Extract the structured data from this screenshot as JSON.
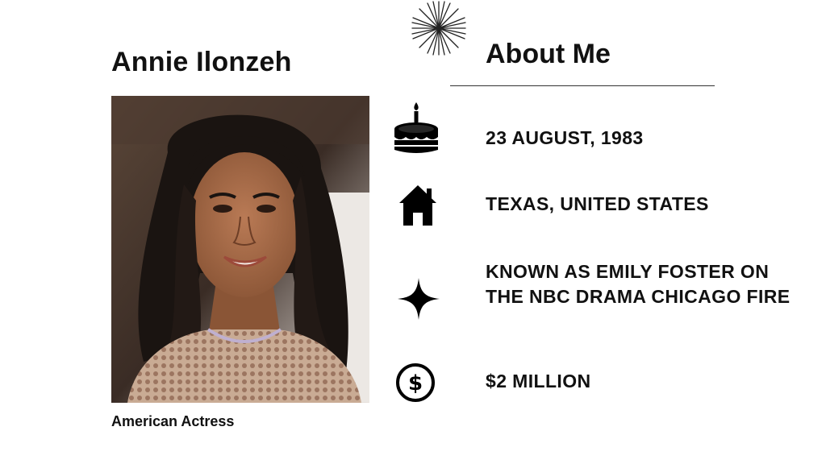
{
  "profile": {
    "name": "Annie Ilonzeh",
    "caption": "American Actress"
  },
  "about": {
    "heading": "About Me",
    "facts": [
      {
        "icon": "birthday-cake-icon",
        "text": "23 AUGUST, 1983"
      },
      {
        "icon": "house-icon",
        "text": "TEXAS, UNITED STATES"
      },
      {
        "icon": "sparkle-star-icon",
        "text": "KNOWN AS EMILY FOSTER ON THE NBC DRAMA CHICAGO FIRE"
      },
      {
        "icon": "dollar-coin-icon",
        "text": "$2 MILLION"
      }
    ]
  },
  "colors": {
    "background": "#ffffff",
    "text": "#111111"
  }
}
